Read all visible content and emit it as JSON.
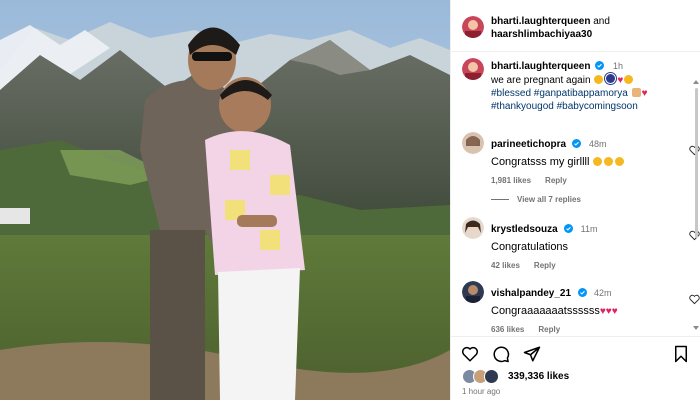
{
  "post": {
    "author": "bharti.laughterqueen",
    "and_label": "and",
    "coauthor": "haarshlimbachiyaa30"
  },
  "caption": {
    "username": "bharti.laughterqueen",
    "time": "1h",
    "text": "we are pregnant again",
    "hashtags": "#blessed #ganpatibappamorya",
    "hashtags2": "#thankyougod #babycomingsoon"
  },
  "comments": [
    {
      "username": "parineetichopra",
      "time": "48m",
      "text": "Congratsss my girllll",
      "likes": "1,981 likes",
      "reply": "Reply"
    },
    {
      "username": "krystledsouza",
      "time": "11m",
      "text": "Congratulations",
      "likes": "42 likes",
      "reply": "Reply"
    },
    {
      "username": "vishalpandey_21",
      "time": "42m",
      "text": "Congraaaaaaatssssss",
      "likes": "636 likes",
      "reply": "Reply"
    }
  ],
  "view_replies": "View all 7 replies",
  "likes_count": "339,336 likes",
  "posted_time": "1 hour ago",
  "colors": {
    "link": "#00376b",
    "heart": "#e0245e",
    "verified": "#0095f6"
  },
  "icons": [
    "heart-icon",
    "comment-icon",
    "share-icon",
    "bookmark-icon",
    "verified-badge-icon"
  ]
}
